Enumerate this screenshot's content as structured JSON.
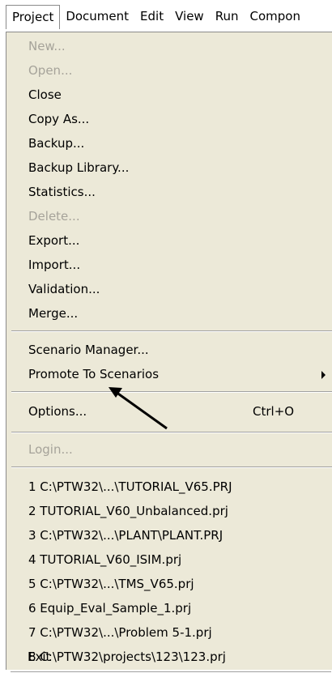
{
  "menubar": {
    "items": [
      "Project",
      "Document",
      "Edit",
      "View",
      "Run",
      "Compon"
    ]
  },
  "project_menu": {
    "items": [
      {
        "label": "New...",
        "enabled": false
      },
      {
        "label": "Open...",
        "enabled": false
      },
      {
        "label": "Close",
        "enabled": true
      },
      {
        "label": "Copy As...",
        "enabled": true
      },
      {
        "label": "Backup...",
        "enabled": true
      },
      {
        "label": "Backup Library...",
        "enabled": true
      },
      {
        "label": "Statistics...",
        "enabled": true
      },
      {
        "label": "Delete...",
        "enabled": false
      },
      {
        "label": "Export...",
        "enabled": true
      },
      {
        "label": "Import...",
        "enabled": true
      },
      {
        "label": "Validation...",
        "enabled": true
      },
      {
        "label": "Merge...",
        "enabled": true
      },
      {
        "label": "Scenario Manager...",
        "enabled": true
      },
      {
        "label": "Promote To Scenarios",
        "enabled": true,
        "submenu": true
      },
      {
        "label": "Options...",
        "enabled": true,
        "shortcut": "Ctrl+O"
      },
      {
        "label": "Login...",
        "enabled": false
      },
      {
        "label": "1 C:\\PTW32\\...\\TUTORIAL_V65.PRJ",
        "enabled": true
      },
      {
        "label": "2 TUTORIAL_V60_Unbalanced.prj",
        "enabled": true
      },
      {
        "label": "3 C:\\PTW32\\...\\PLANT\\PLANT.PRJ",
        "enabled": true
      },
      {
        "label": "4 TUTORIAL_V60_ISIM.prj",
        "enabled": true
      },
      {
        "label": "5 C:\\PTW32\\...\\TMS_V65.prj",
        "enabled": true
      },
      {
        "label": "6 Equip_Eval_Sample_1.prj",
        "enabled": true
      },
      {
        "label": "7 C:\\PTW32\\...\\Problem 5-1.prj",
        "enabled": true
      },
      {
        "label": "8 C:\\PTW32\\projects\\123\\123.prj",
        "enabled": true
      },
      {
        "label": "Exit",
        "enabled": true
      }
    ]
  },
  "colors": {
    "menu_background": "#ece9d8",
    "disabled_text": "#a6a39a",
    "text": "#000000"
  },
  "annotation": {
    "type": "arrow",
    "points_to": "Options..."
  }
}
